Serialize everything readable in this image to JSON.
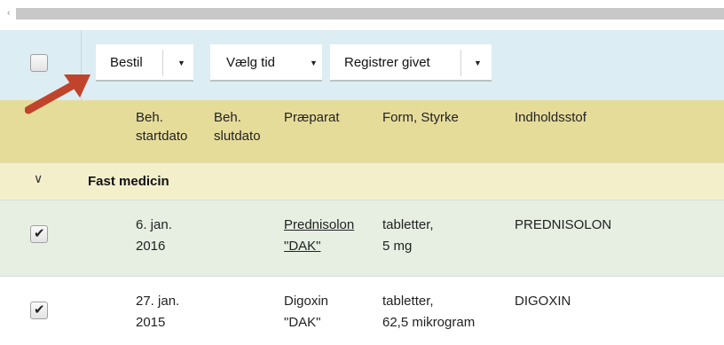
{
  "scrollbar": {
    "arrow": "‹"
  },
  "toolbar": {
    "order_label": "Bestil",
    "time_label": "Vælg tid",
    "register_label": "Registrer givet",
    "caret": "▼"
  },
  "header": {
    "col_start_line1": "Beh.",
    "col_start_line2": "startdato",
    "col_end_line1": "Beh.",
    "col_end_line2": "slutdato",
    "col_drug": "Præparat",
    "col_form": "Form, Styrke",
    "col_substance": "Indholdsstof"
  },
  "group": {
    "chevron": "∨",
    "title": "Fast medicin"
  },
  "rows": [
    {
      "checked": "✔",
      "start_line1": "6. jan.",
      "start_line2": "2016",
      "drug_line1": "Prednisolon",
      "drug_line2": "\"DAK\"",
      "form_line1": "tabletter,",
      "form_line2": "5 mg",
      "substance": "PREDNISOLON"
    },
    {
      "checked": "✔",
      "start_line1": "27. jan.",
      "start_line2": "2015",
      "drug_line1": "Digoxin",
      "drug_line2": "\"DAK\"",
      "form_line1": "tabletter,",
      "form_line2": "62,5 mikrogram",
      "substance": "DIGOXIN"
    }
  ],
  "colors": {
    "annotation_arrow": "#c0432b",
    "toolbar_bg": "#dcedf3",
    "header_bg": "#e6dc9a"
  }
}
